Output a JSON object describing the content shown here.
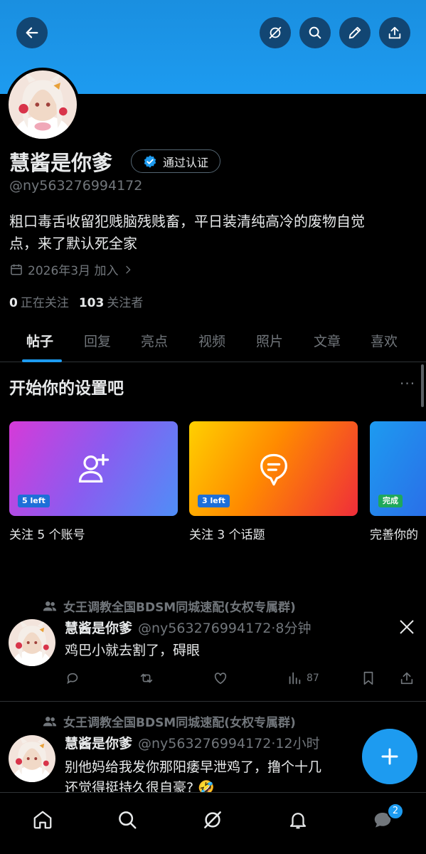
{
  "header": {
    "buttons": [
      {
        "icon": "back-arrow-icon"
      },
      {
        "icon": "grok-icon"
      },
      {
        "icon": "search-icon"
      },
      {
        "icon": "edit-pencil-icon"
      },
      {
        "icon": "share-icon"
      }
    ],
    "banner_color": "#1d9bf0"
  },
  "profile": {
    "display_name": "慧酱是你爹",
    "verify_label": "通过认证",
    "handle": "@ny563276994172",
    "bio_line1": "粗口毒舌收留犯贱脑残贱畜，平日装清纯高冷的废物自觉",
    "bio_line2": "点，来了默认死全家",
    "joined": "2026年3月 加入",
    "following_count": "0",
    "following_label": "正在关注",
    "followers_count": "103",
    "followers_label": "关注者"
  },
  "tabs": [
    "帖子",
    "回复",
    "亮点",
    "视频",
    "照片",
    "文章",
    "喜欢"
  ],
  "active_tab": 0,
  "setup": {
    "title": "开始你的设置吧",
    "more": "···",
    "cards": [
      {
        "badge": "5 left",
        "label": "关注 5 个账号",
        "icon": "add-user-icon"
      },
      {
        "badge": "3 left",
        "label": "关注 3 个话题",
        "icon": "topic-bubble-icon"
      },
      {
        "badge": "完成",
        "label": "完善你的",
        "icon": ""
      }
    ]
  },
  "posts": [
    {
      "group": "女王调教全国BDSM同城速配(女权专属群)",
      "name": "慧酱是你爹",
      "meta": "@ny563276994172·8分钟",
      "text_lines": [
        "鸡巴小就去割了，碍眼"
      ],
      "views": "87"
    },
    {
      "group": "女王调教全国BDSM同城速配(女权专属群)",
      "name": "慧酱是你爹",
      "meta": "@ny563276994172·12小时",
      "text_lines": [
        "别他妈给我发你那阳痿早泄鸡了，撸个十几",
        "还觉得挺持久很自豪? 🤣"
      ]
    }
  ],
  "bottom_nav": {
    "items": [
      "home-icon",
      "search-icon",
      "grok-icon",
      "notifications-icon",
      "messages-icon"
    ],
    "messages_badge": "2"
  },
  "colors": {
    "accent": "#1d9bf0",
    "text_primary": "#e7e9ea",
    "text_secondary": "#71767b",
    "divider": "#2f3336"
  }
}
